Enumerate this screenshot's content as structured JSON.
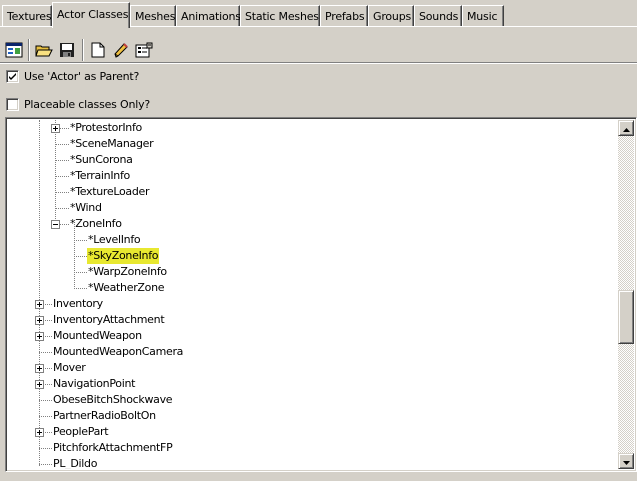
{
  "tabs": [
    {
      "label": "Textures",
      "active": false
    },
    {
      "label": "Actor Classes",
      "active": true
    },
    {
      "label": "Meshes",
      "active": false
    },
    {
      "label": "Animations",
      "active": false
    },
    {
      "label": "Static Meshes",
      "active": false
    },
    {
      "label": "Prefabs",
      "active": false
    },
    {
      "label": "Groups",
      "active": false
    },
    {
      "label": "Sounds",
      "active": false
    },
    {
      "label": "Music",
      "active": false
    }
  ],
  "toolbar": {
    "buttons": [
      "browser-icon",
      "open-folder-icon",
      "save-icon",
      "new-document-icon",
      "edit-pencil-icon",
      "properties-icon"
    ]
  },
  "options": {
    "use_actor_parent": {
      "label": "Use 'Actor' as Parent?",
      "checked": true
    },
    "placeable_only": {
      "label": "Placeable classes Only?",
      "checked": false
    }
  },
  "tree": {
    "items": [
      {
        "label": "*ProtestorInfo",
        "expander": "plus"
      },
      {
        "label": "*SceneManager"
      },
      {
        "label": "*SunCorona"
      },
      {
        "label": "*TerrainInfo"
      },
      {
        "label": "*TextureLoader"
      },
      {
        "label": "*Wind"
      },
      {
        "label": "*ZoneInfo",
        "expander": "minus"
      },
      {
        "label": "*LevelInfo"
      },
      {
        "label": "*SkyZoneInfo",
        "selected": true
      },
      {
        "label": "*WarpZoneInfo"
      },
      {
        "label": "*WeatherZone"
      },
      {
        "label": "Inventory",
        "expander": "plus"
      },
      {
        "label": "InventoryAttachment",
        "expander": "plus"
      },
      {
        "label": "MountedWeapon",
        "expander": "plus"
      },
      {
        "label": "MountedWeaponCamera"
      },
      {
        "label": "Mover",
        "expander": "plus"
      },
      {
        "label": "NavigationPoint",
        "expander": "plus"
      },
      {
        "label": "ObeseBitchShockwave"
      },
      {
        "label": "PartnerRadioBoltOn"
      },
      {
        "label": "PeoplePart",
        "expander": "plus"
      },
      {
        "label": "PitchforkAttachmentFP"
      },
      {
        "label": "PL_Dildo"
      }
    ],
    "selection_color": "#e8e830"
  }
}
